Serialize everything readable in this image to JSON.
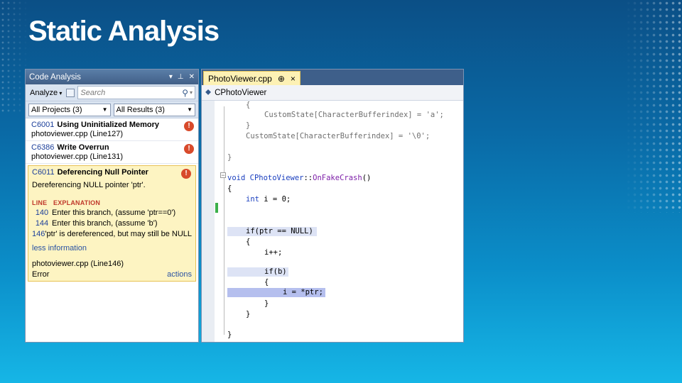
{
  "slide": {
    "title": "Static Analysis"
  },
  "code_analysis": {
    "panel_title": "Code Analysis",
    "pin_glyph": "▾ ↕ ×",
    "analyze_label": "Analyze",
    "search_placeholder": "Search",
    "projects_filter": "All Projects (3)",
    "results_filter": "All Results (3)",
    "items": [
      {
        "code": "C6001",
        "name": "Using Uninitialized Memory",
        "location": "photoviewer.cpp (Line127)"
      },
      {
        "code": "C6386",
        "name": "Write Overrun",
        "location": "photoviewer.cpp (Line131)"
      }
    ],
    "selected": {
      "code": "C6011",
      "name": "Deferencing Null Pointer",
      "description": "Dereferencing NULL pointer 'ptr'.",
      "col_line": "LINE",
      "col_explanation": "EXPLANATION",
      "rows": [
        {
          "line": "140",
          "text": "Enter this branch, (assume 'ptr==0')"
        },
        {
          "line": "144",
          "text": "Enter this branch, (assume 'b')"
        },
        {
          "line": "146",
          "text": "'ptr' is dereferenced, but may still be NULL"
        }
      ],
      "less_info": "less information",
      "location": "photoviewer.cpp (Line146)",
      "severity": "Error",
      "actions": "actions"
    }
  },
  "editor": {
    "tab_label": "PhotoViewer.cpp",
    "tab_pin": "⊕",
    "tab_close": "×",
    "nav_class": "CPhotoViewer",
    "lines": {
      "l1": "{",
      "l2a": "Custom",
      "l2": "CustomState[CharacterBufferindex] = 'a';",
      "l3": "}",
      "l4": "CustomState[CharacterBufferindex] = '\\0';",
      "l5": "}",
      "l6_void": "void",
      "l6_cls": "CPhotoViewer",
      "l6_sep": "::",
      "l6_fn": "OnFakeCrash",
      "l6_end": "()",
      "l7": "{",
      "l8_kw": "int",
      "l8_rest": " i = 0;",
      "l9": "if(ptr == NULL)",
      "l10": "{",
      "l11": "i++;",
      "l12": "if(b)",
      "l13": "{",
      "l14": "i = *ptr;",
      "l15": "}",
      "l16": "}",
      "l17": "}"
    }
  },
  "colors": {
    "accent": "#3e5f8a",
    "warning": "#d84a2b",
    "selection": "#fdf4c2"
  }
}
